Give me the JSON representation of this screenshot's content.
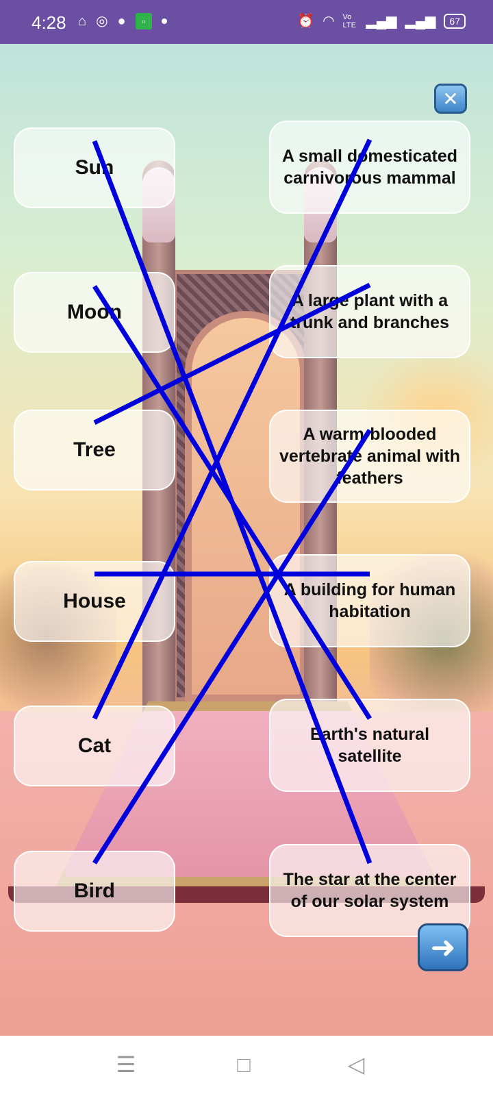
{
  "status_bar": {
    "time": "4:28",
    "left_icons": [
      "mosque-icon",
      "whatsapp-icon",
      "chat-bubble-icon",
      "app-notification-icon",
      "dot-icon"
    ],
    "right_icons": [
      "alarm-icon",
      "wifi-icon",
      "volte-icon",
      "signal-icon",
      "signal-icon-2"
    ],
    "volte_label": "Vo LTE",
    "battery": "67"
  },
  "game": {
    "left_items": [
      {
        "label": "Sun"
      },
      {
        "label": "Moon"
      },
      {
        "label": "Tree"
      },
      {
        "label": "House"
      },
      {
        "label": "Cat"
      },
      {
        "label": "Bird"
      }
    ],
    "right_items": [
      {
        "label": "A small domesticated carnivorous mammal"
      },
      {
        "label": "A large plant with a trunk and branches"
      },
      {
        "label": "A warm-blooded vertebrate animal with feathers"
      },
      {
        "label": "A building for human habitation"
      },
      {
        "label": "Earth's natural satellite"
      },
      {
        "label": "The star at the center of our solar system"
      }
    ],
    "links": [
      [
        0,
        5
      ],
      [
        1,
        4
      ],
      [
        2,
        1
      ],
      [
        3,
        3
      ],
      [
        4,
        0
      ],
      [
        5,
        2
      ]
    ],
    "line_color": "#0000dd",
    "close_glyph": "✕",
    "next_glyph": "➜"
  },
  "nav_bar": {
    "menu_glyph": "☰",
    "home_glyph": "□",
    "back_glyph": "◁"
  }
}
